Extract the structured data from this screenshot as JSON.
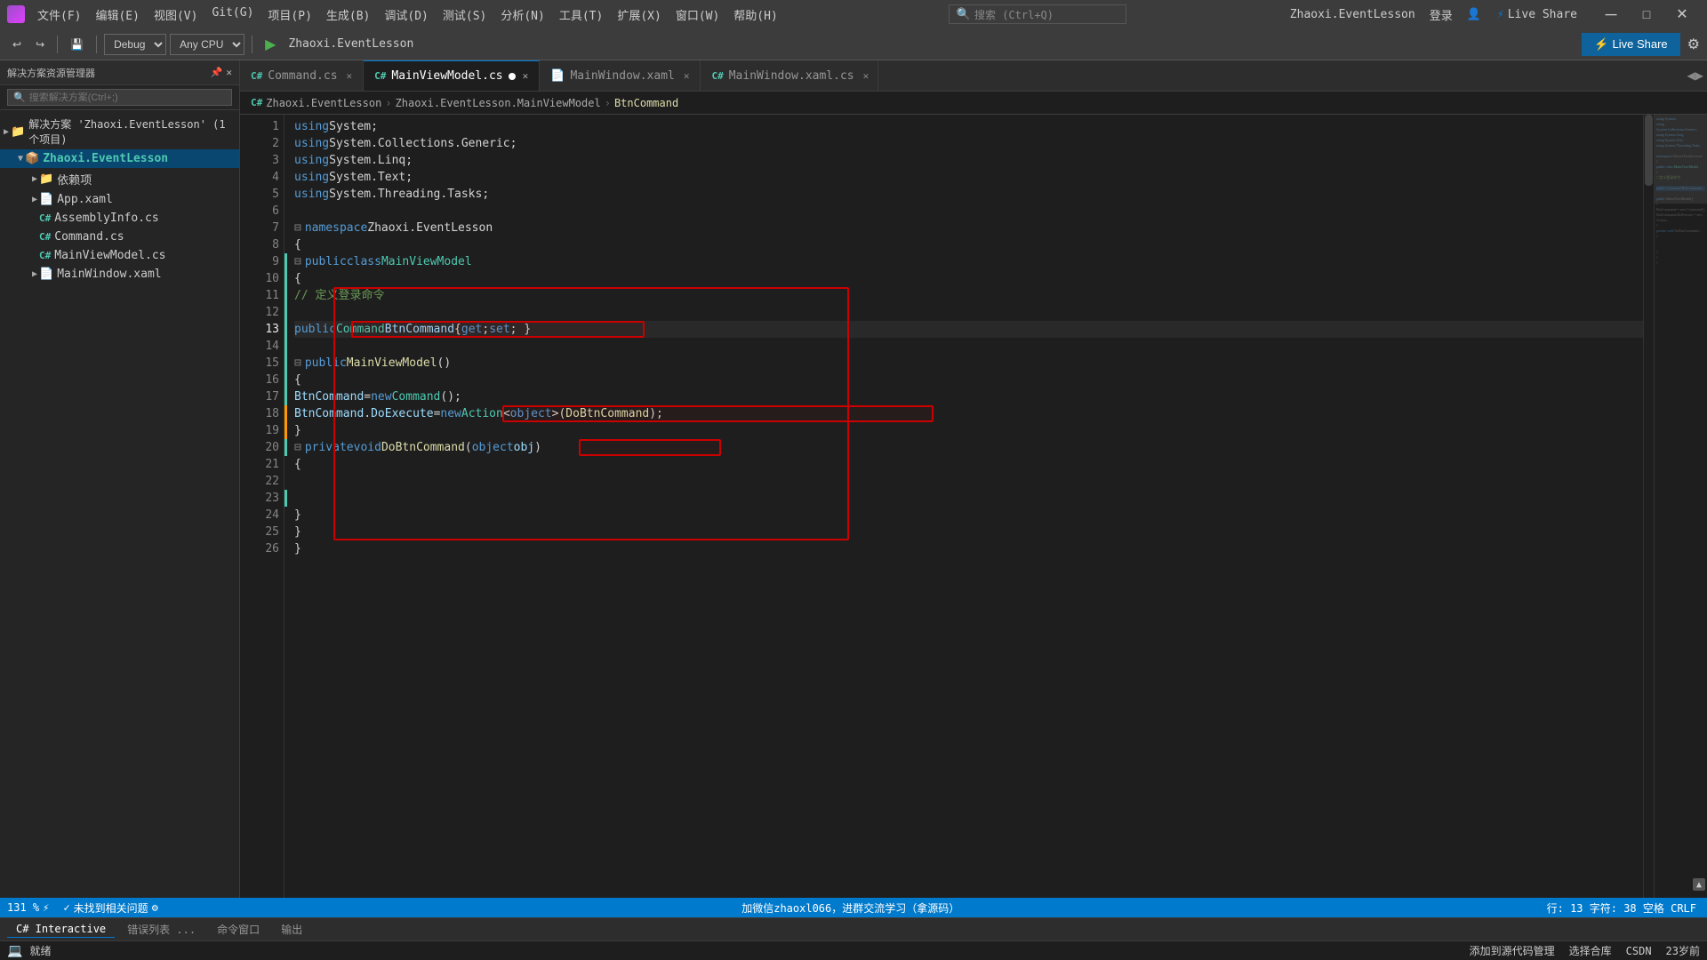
{
  "titleBar": {
    "appTitle": "Zhaoxi.EventLesson",
    "menus": [
      "文件(F)",
      "编辑(E)",
      "视图(V)",
      "Git(G)",
      "项目(P)",
      "生成(B)",
      "调试(D)",
      "测试(S)",
      "分析(N)",
      "工具(T)",
      "扩展(X)",
      "窗口(W)",
      "帮助(H)"
    ],
    "searchPlaceholder": "搜索 (Ctrl+Q)",
    "loginText": "登录",
    "liveShareText": "Live Share"
  },
  "toolbar": {
    "debugConfig": "Debug",
    "platform": "Any CPU",
    "project": "Zhaoxi.EventLesson"
  },
  "sidebar": {
    "title": "解决方案资源管理器",
    "searchPlaceholder": "搜索解决方案(Ctrl+;)",
    "items": [
      {
        "label": "解决方案 'Zhaoxi.EventLesson' (1 个项目)",
        "level": 0,
        "icon": "📁",
        "expanded": true
      },
      {
        "label": "Zhaoxi.EventLesson",
        "level": 1,
        "icon": "📦",
        "expanded": true,
        "selected": true
      },
      {
        "label": "依赖项",
        "level": 2,
        "icon": "📁",
        "expanded": false
      },
      {
        "label": "App.xaml",
        "level": 2,
        "icon": "📄",
        "expanded": false
      },
      {
        "label": "AssemblyInfo.cs",
        "level": 2,
        "icon": "C#",
        "expanded": false
      },
      {
        "label": "Command.cs",
        "level": 2,
        "icon": "C#",
        "expanded": false
      },
      {
        "label": "MainViewModel.cs",
        "level": 2,
        "icon": "C#",
        "expanded": false
      },
      {
        "label": "MainWindow.xaml",
        "level": 2,
        "icon": "📄",
        "expanded": false
      }
    ]
  },
  "tabs": [
    {
      "label": "Command.cs",
      "active": false,
      "modified": false
    },
    {
      "label": "MainViewModel.cs",
      "active": true,
      "modified": true
    },
    {
      "label": "MainWindow.xaml",
      "active": false,
      "modified": false
    },
    {
      "label": "MainWindow.xaml.cs",
      "active": false,
      "modified": false
    }
  ],
  "breadcrumb": {
    "parts": [
      "Zhaoxi.EventLesson",
      "Zhaoxi.EventLesson.MainViewModel",
      "BtnCommand"
    ]
  },
  "codeLines": [
    {
      "num": 1,
      "content": "using System;"
    },
    {
      "num": 2,
      "content": "using System.Collections.Generic;"
    },
    {
      "num": 3,
      "content": "using System.Linq;"
    },
    {
      "num": 4,
      "content": "using System.Text;"
    },
    {
      "num": 5,
      "content": "using System.Threading.Tasks;"
    },
    {
      "num": 6,
      "content": ""
    },
    {
      "num": 7,
      "content": "namespace Zhaoxi.EventLesson"
    },
    {
      "num": 8,
      "content": "{"
    },
    {
      "num": 9,
      "content": "    public class MainViewModel"
    },
    {
      "num": 10,
      "content": "    {"
    },
    {
      "num": 11,
      "content": "        // 定义登录命令"
    },
    {
      "num": 12,
      "content": ""
    },
    {
      "num": 13,
      "content": "        public Command BtnCommand { get; set; }"
    },
    {
      "num": 14,
      "content": ""
    },
    {
      "num": 15,
      "content": "        public MainViewModel()"
    },
    {
      "num": 16,
      "content": "        {"
    },
    {
      "num": 17,
      "content": "            BtnCommand = new Command();"
    },
    {
      "num": 18,
      "content": "            BtnCommand.DoExecute = new Action<object>(DoBtnCommand);"
    },
    {
      "num": 19,
      "content": "        }"
    },
    {
      "num": 20,
      "content": "        private void DoBtnCommand(object obj)"
    },
    {
      "num": 21,
      "content": "        {"
    },
    {
      "num": 22,
      "content": ""
    },
    {
      "num": 23,
      "content": ""
    },
    {
      "num": 24,
      "content": "        }"
    },
    {
      "num": 25,
      "content": "    }"
    },
    {
      "num": 26,
      "content": "}"
    }
  ],
  "statusBar": {
    "zoomLevel": "131 %",
    "noIssues": "未找到相关问题",
    "position": "行: 13    字符: 38    空格    CRLF",
    "encoding": "C# Interactive",
    "errorList": "错误列表 ...",
    "commandWindow": "命令窗口",
    "output": "输出",
    "message": "加微信zhaoxl066，进群交流学习（拿源码）"
  },
  "bottomTabs": [
    "C# Interactive",
    "错误列表 ...",
    "命令窗口",
    "输出"
  ],
  "taskbar": {
    "icon": "就绪",
    "rightItems": [
      "添加到源代码管理",
      "选择合库",
      "CSDN",
      "23岁前"
    ]
  }
}
